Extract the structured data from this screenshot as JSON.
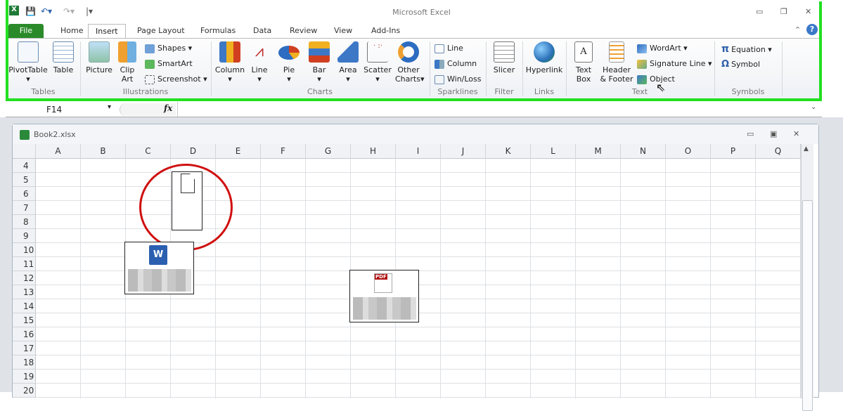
{
  "app_title": "Microsoft Excel",
  "tabs": [
    "File",
    "Home",
    "Insert",
    "Page Layout",
    "Formulas",
    "Data",
    "Review",
    "View",
    "Add-Ins"
  ],
  "active_tab": "Insert",
  "ribbon": {
    "tables": {
      "label": "Tables",
      "pivot": "PivotTable",
      "table": "Table"
    },
    "illustrations": {
      "label": "Illustrations",
      "picture": "Picture",
      "clip1": "Clip",
      "clip2": "Art",
      "shapes": "Shapes",
      "smartart": "SmartArt",
      "screenshot": "Screenshot"
    },
    "charts": {
      "label": "Charts",
      "items": [
        "Column",
        "Line",
        "Pie",
        "Bar",
        "Area",
        "Scatter"
      ],
      "other1": "Other",
      "other2": "Charts"
    },
    "sparklines": {
      "label": "Sparklines",
      "line": "Line",
      "column": "Column",
      "winloss": "Win/Loss"
    },
    "filter": {
      "label": "Filter",
      "slicer": "Slicer"
    },
    "links": {
      "label": "Links",
      "hyperlink": "Hyperlink"
    },
    "text": {
      "label": "Text",
      "textbox1": "Text",
      "textbox2": "Box",
      "header1": "Header",
      "header2": "& Footer",
      "wordart": "WordArt",
      "signature": "Signature Line",
      "object": "Object"
    },
    "symbols": {
      "label": "Symbols",
      "equation": "Equation",
      "symbol": "Symbol"
    }
  },
  "formula_bar": {
    "name_box": "F14",
    "fx": "fx",
    "value": ""
  },
  "workbook": {
    "title": "Book2.xlsx",
    "columns": [
      "A",
      "B",
      "C",
      "D",
      "E",
      "F",
      "G",
      "H",
      "I",
      "J",
      "K",
      "L",
      "M",
      "N",
      "O",
      "P",
      "Q"
    ],
    "rows": [
      "4",
      "5",
      "6",
      "7",
      "8",
      "9",
      "10",
      "11",
      "12",
      "13",
      "14",
      "15",
      "16",
      "17",
      "18",
      "19",
      "20"
    ]
  },
  "colors": {
    "accent_green": "#22e022",
    "file_tab": "#2a8a2a",
    "highlight_circle": "#d01010"
  }
}
